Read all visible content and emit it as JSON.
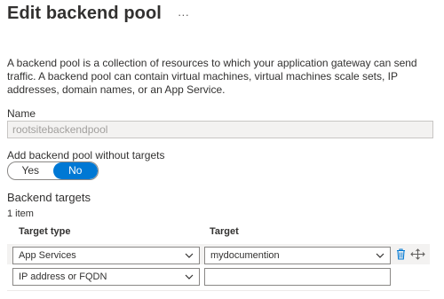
{
  "header": {
    "title": "Edit backend pool",
    "more_label": "···"
  },
  "description": "A backend pool is a collection of resources to which your application gateway can send traffic. A backend pool can contain virtual machines, virtual machines scale sets, IP addresses, domain names, or an App Service.",
  "name_field": {
    "label": "Name",
    "value": "rootsitebackendpool"
  },
  "without_targets": {
    "label": "Add backend pool without targets",
    "options": [
      "Yes",
      "No"
    ],
    "selected": "No"
  },
  "backend_targets": {
    "title": "Backend targets",
    "count": "1 item",
    "columns": {
      "target_type": "Target type",
      "target": "Target"
    },
    "rows": [
      {
        "target_type": "App Services",
        "target": "mydocumention"
      }
    ],
    "new_row": {
      "target_type": "IP address or FQDN",
      "target": ""
    }
  },
  "icons": {
    "delete": "trash-icon",
    "drag": "drag-handle-icon",
    "chevron": "chevron-down-icon"
  },
  "colors": {
    "accent": "#0078d4",
    "disabled_bg": "#f3f2f1",
    "border": "#8a8886"
  }
}
